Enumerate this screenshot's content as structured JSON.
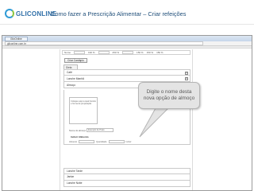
{
  "slide": {
    "logo_text": "GLICONLINE",
    "title": "Como fazer a Prescrição Alimentar – Criar refeições"
  },
  "browser": {
    "tab_label": "GlicOnline",
    "url": "gliconline.com.br"
  },
  "app": {
    "header_cells": [
      "Nome",
      "190 %",
      "250 %",
      "150 %",
      "150 %",
      "150 %"
    ],
    "create_button": "Criar Cardápio",
    "section_tab": "Dieta",
    "meals_top": [
      "Café",
      "Lanche Manhã",
      "Almoço"
    ],
    "textarea_placeholder": "Coloque aqui a qual horário e forma de preparação",
    "nome_label": "Nome do almoço",
    "nome_value": "Exemplo de Prato",
    "substitutes_title": "Incluir Alimento",
    "row_labels": [
      "Alimento",
      "Quantidade",
      "Incluir"
    ],
    "meals_bottom": [
      "Lanche Tarde",
      "Jantar",
      "Lanche Noite"
    ]
  },
  "callout": {
    "text": "Digite o nome desta nova opção de almoço"
  }
}
